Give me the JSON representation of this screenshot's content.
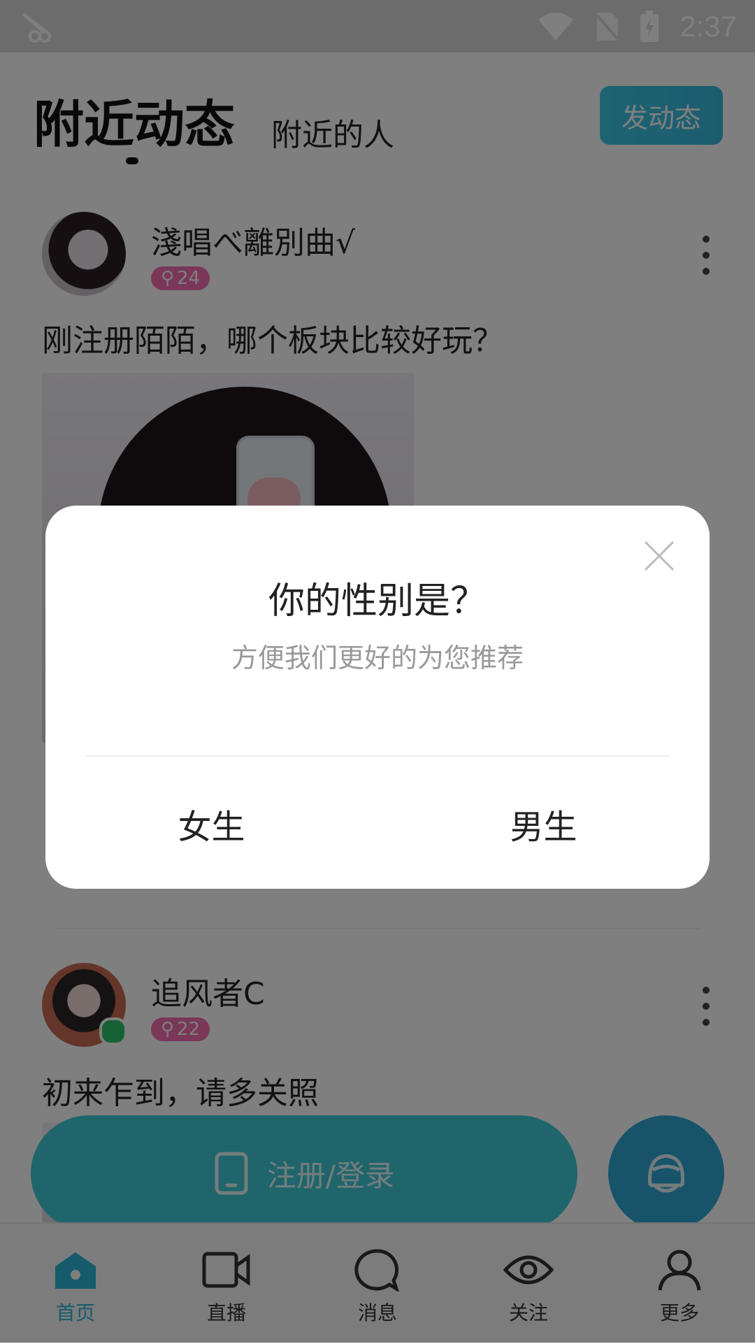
{
  "status_bar": {
    "time": "2:37"
  },
  "header": {
    "tab_active": "附近动态",
    "tab_other": "附近的人",
    "post_button": "发动态"
  },
  "feed": [
    {
      "username": "淺唱べ離別曲√",
      "age": "24",
      "text": "刚注册陌陌，哪个板块比较好玩？"
    },
    {
      "username": "追风者C",
      "age": "22",
      "text": "初来乍到，请多关照"
    }
  ],
  "floating": {
    "login_label": "注册/登录"
  },
  "tabbar": {
    "items": [
      {
        "label": "首页",
        "icon": "home-icon"
      },
      {
        "label": "直播",
        "icon": "video-camera-icon"
      },
      {
        "label": "消息",
        "icon": "chat-bubble-icon"
      },
      {
        "label": "关注",
        "icon": "eye-icon"
      },
      {
        "label": "更多",
        "icon": "person-icon"
      }
    ]
  },
  "dialog": {
    "title": "你的性别是？",
    "subtitle": "方便我们更好的为您推荐",
    "option_female": "女生",
    "option_male": "男生"
  },
  "colors": {
    "accent": "#2ab7d6",
    "badge": "#f46fb0",
    "online": "#2dc26a"
  }
}
